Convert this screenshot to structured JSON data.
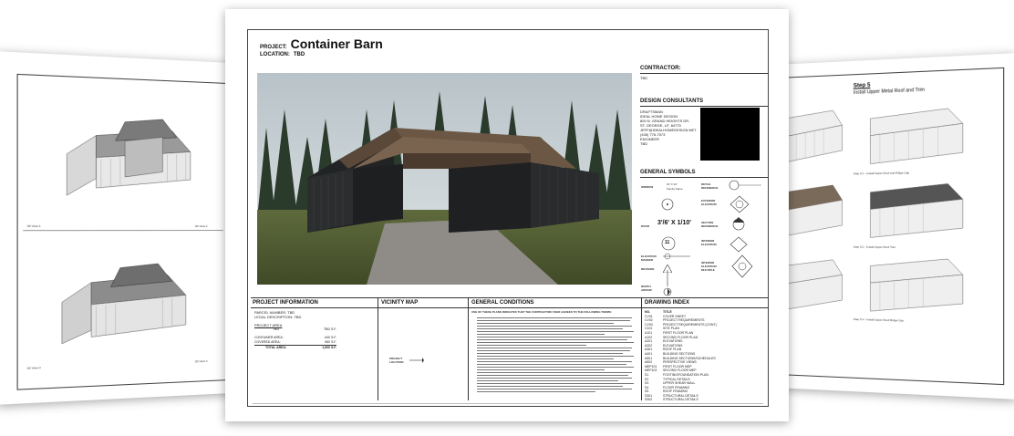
{
  "main_sheet": {
    "project_label": "PROJECT:",
    "project_name": "Container Barn",
    "location_label": "LOCATION:",
    "location_value": "TBD",
    "contractor_label": "CONTRACTOR:",
    "contractor_value": "TBD",
    "design_consultants_title": "DESIGN CONSULTANTS",
    "consultant_lines": [
      "DRAFTSMAN",
      "IDEAL HOME DESIGN",
      "800 N. GRAND HEIGHTS DR.",
      "ST. GEORGE, UT, 84770",
      "JEFF@IDEALHOMEDESIGN.NET",
      "(435) 776-7573",
      "ENGINEER",
      "TBD"
    ],
    "general_symbols_title": "GENERAL SYMBOLS",
    "symbols": {
      "window": "WINDOW",
      "window_tag": "16' X 10'",
      "window_sub": "Family Name",
      "detail_reference": "DETAIL REFERENCE",
      "exterior_elevation": "EXTERIOR ELEVATION",
      "door": "DOOR",
      "door_tag": "3'/6' X 1/10'",
      "section_reference": "SECTION REFERENCE",
      "interior_elevation": "INTERIOR ELEVATION",
      "elevation_marker": "ELEVATION MARKER",
      "revision": "REVISION",
      "interior_elevation_multiple": "INTERIOR ELEVATION MULTIPLE",
      "north_arrow": "NORTH ARROW",
      "revision_num": "11"
    },
    "sections": {
      "project_information": "PROJECT INFORMATION",
      "vicinity_map": "VICINITY MAP",
      "general_conditions": "GENERAL CONDITIONS",
      "drawing_index": "DRAWING INDEX"
    },
    "project_info": {
      "parcel_number": "PARCEL NUMBER: TBD",
      "legal_description": "LEGAL DESCRIPTION: TBD",
      "project_area_label": "PROJECT AREA",
      "tbd_label": "TBD",
      "tbd_value": "TBD S.F.",
      "container_area_label": "CONTAINER AREA:",
      "container_area_value": "640 S.F.",
      "covered_area_label": "COVERED AREA:",
      "covered_area_value": "960 S.F.",
      "total_area_label": "TOTAL AREA:",
      "total_area_value": "1,600 S.F."
    },
    "vicinity": {
      "marker_label": "PROJECT LOCATION"
    },
    "general_conditions_intro": "USE OF THESE PLANS INDICATES THAT THE CONTRACTOR/ USER AGREES TO THE FOLLOWING TERMS:",
    "drawing_index_header": {
      "no": "NO.",
      "title": "TITLE"
    },
    "drawing_index": [
      {
        "no": "CV01",
        "title": "COVER SHEET"
      },
      {
        "no": "CV02",
        "title": "PROJECT REQUIREMENTS"
      },
      {
        "no": "CV03",
        "title": "PROJECT REQUIREMENTS (CONT.)"
      },
      {
        "no": "C101",
        "title": "SITE PLAN"
      },
      {
        "no": "A101",
        "title": "FIRST FLOOR PLAN"
      },
      {
        "no": "A102",
        "title": "SECOND FLOOR PLAN"
      },
      {
        "no": "A201",
        "title": "ELEVATIONS"
      },
      {
        "no": "A202",
        "title": "ELEVATIONS"
      },
      {
        "no": "A301",
        "title": "ROOF PLAN"
      },
      {
        "no": "A401",
        "title": "BUILDING SECTIONS"
      },
      {
        "no": "A501",
        "title": "BUILDING SECTIONS/SCHEDULES"
      },
      {
        "no": "A502",
        "title": "PERSPECTIVE VIEWS"
      },
      {
        "no": "MEP101",
        "title": "FIRST FLOOR MEP"
      },
      {
        "no": "MEP102",
        "title": "SECOND FLOOR MEP"
      },
      {
        "no": "S1",
        "title": "FOOTING/FOUNDATION PLAN"
      },
      {
        "no": "S2",
        "title": "TYPICAL DETAILS"
      },
      {
        "no": "S3",
        "title": "UPPER SHEAR WALL"
      },
      {
        "no": "S4",
        "title": "FLOOR FRAMING"
      },
      {
        "no": "S5",
        "title": "ROOF FRAMING"
      },
      {
        "no": "S301",
        "title": "STRUCTURAL DETAILS"
      },
      {
        "no": "S302",
        "title": "STRUCTURAL DETAILS"
      }
    ]
  },
  "left_sheet": {
    "view_labels": [
      "3D View 1",
      "3D View 2",
      "3D View 3",
      "3D View 4"
    ]
  },
  "right_sheet": {
    "step_title": "Step 5",
    "step_subtitle": "Install Upper Metal Roof and Trim",
    "captions": [
      "Step 5.1 - Install Upper Roof and Ridge Cap",
      "Step 5.2 - Install Upper Roof Trim",
      "Step 5.3 - Install Upper Roof Trim Panels",
      "Step 5.4 - Install Upper Roof Ridge Cap"
    ]
  },
  "colors": {
    "sky": "#c9d3d8",
    "trees": "#2f4230",
    "container_dark": "#2b2b2d",
    "wood": "#6e5a46",
    "gravel": "#8c8a86",
    "grass": "#4f5a33"
  }
}
